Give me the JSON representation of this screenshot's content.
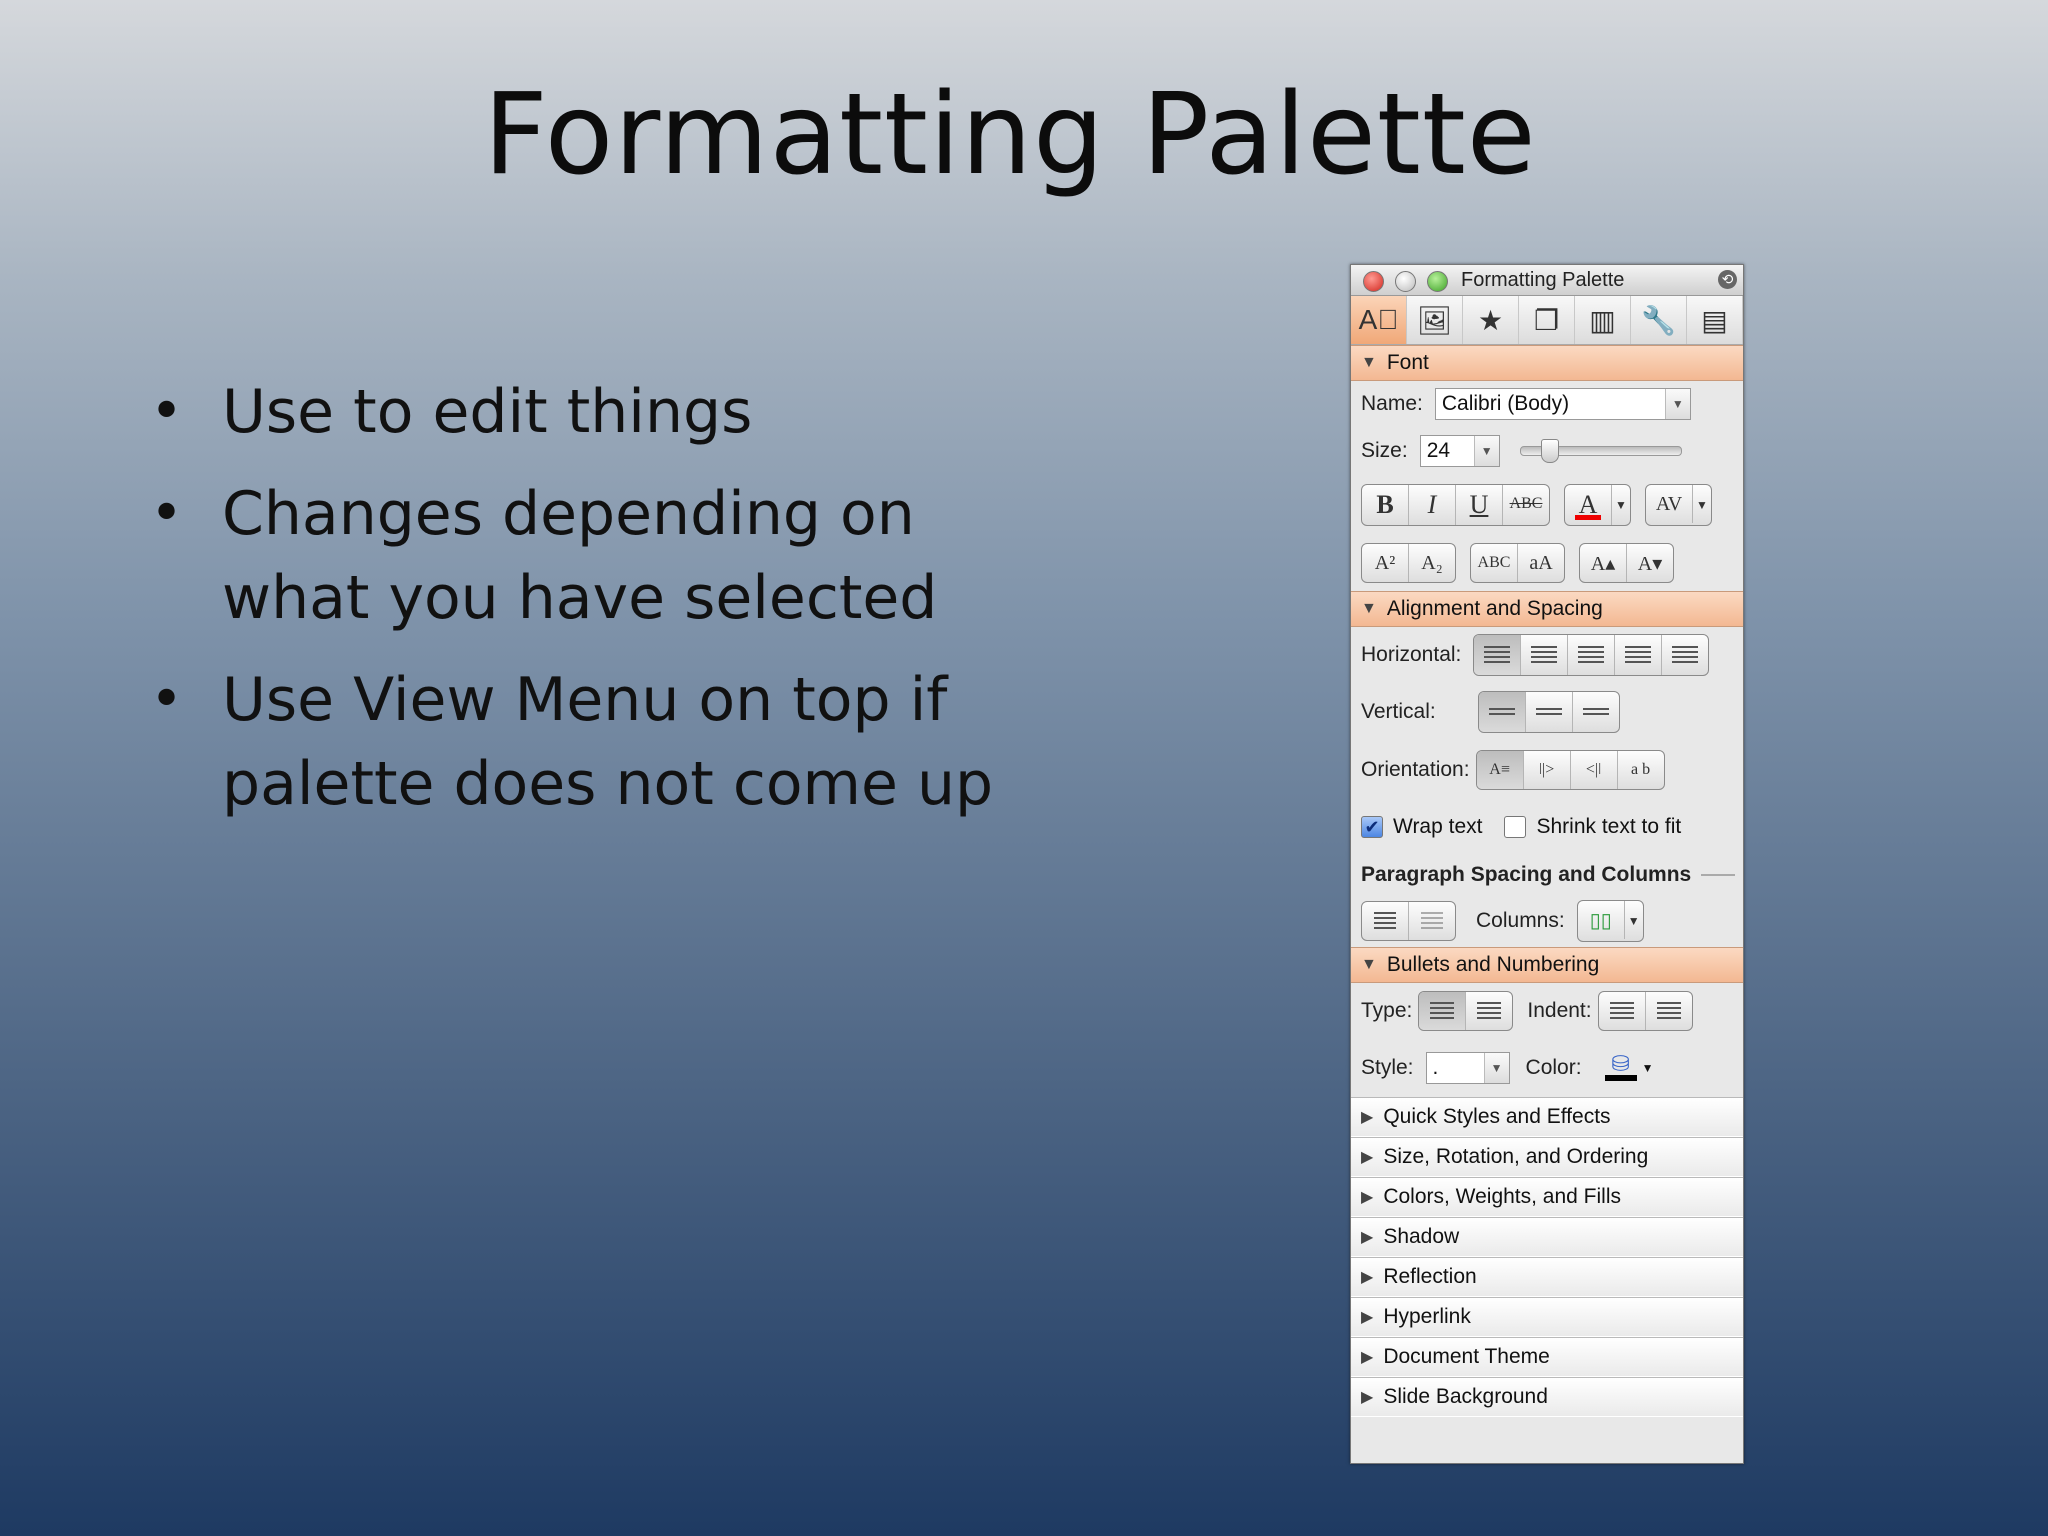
{
  "slide": {
    "title": "Formatting Palette",
    "bullets": [
      "Use to edit things",
      "Changes depending on what you have selected",
      "Use View Menu on top if palette does not come up"
    ]
  },
  "palette": {
    "title": "Formatting Palette",
    "toolbar_icons": [
      "text-format-icon",
      "insert-picture-icon",
      "star-icon",
      "scrapbook-icon",
      "reference-tools-icon",
      "wrench-icon",
      "toolbox-icon"
    ],
    "font": {
      "header": "Font",
      "name_label": "Name:",
      "name_value": "Calibri (Body)",
      "size_label": "Size:",
      "size_value": "24",
      "style_buttons": [
        "B",
        "I",
        "U",
        "ABC"
      ],
      "font_color_glyph": "A",
      "spacing_glyph": "AV",
      "super_glyph": "A²",
      "sub_glyph": "A₂",
      "smallcaps_glyph": "ABC",
      "changecase_glyph": "aA",
      "grow_glyph": "A▴",
      "shrink_glyph": "A▾"
    },
    "alignment": {
      "header": "Alignment and Spacing",
      "horizontal_label": "Horizontal:",
      "vertical_label": "Vertical:",
      "orientation_label": "Orientation:",
      "orientation_glyphs": [
        "A≡",
        "ǀ|>",
        "<|ǀ",
        "a b"
      ],
      "wrap_text_label": "Wrap text",
      "shrink_label": "Shrink text to fit"
    },
    "paragraph": {
      "header": "Paragraph Spacing and Columns",
      "columns_label": "Columns:"
    },
    "bullets": {
      "header": "Bullets and Numbering",
      "type_label": "Type:",
      "indent_label": "Indent:",
      "style_label": "Style:",
      "style_value": ".",
      "color_label": "Color:"
    },
    "collapsed_sections": [
      "Quick Styles and Effects",
      "Size, Rotation, and Ordering",
      "Colors, Weights, and Fills",
      "Shadow",
      "Reflection",
      "Hyperlink",
      "Document Theme",
      "Slide Background"
    ]
  }
}
